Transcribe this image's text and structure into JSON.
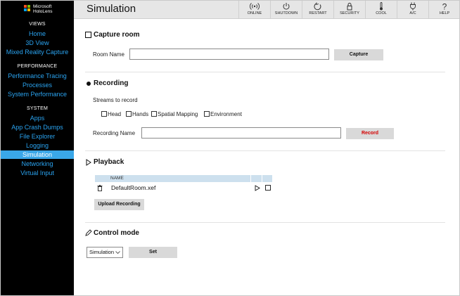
{
  "brand": {
    "line1": "Microsoft",
    "line2": "HoloLens"
  },
  "sidebar": {
    "sections": [
      {
        "title": "VIEWS",
        "items": [
          "Home",
          "3D View",
          "Mixed Reality Capture"
        ]
      },
      {
        "title": "PERFORMANCE",
        "items": [
          "Performance Tracing",
          "Processes",
          "System Performance"
        ]
      },
      {
        "title": "SYSTEM",
        "items": [
          "Apps",
          "App Crash Dumps",
          "File Explorer",
          "Logging",
          "Simulation",
          "Networking",
          "Virtual Input"
        ]
      }
    ],
    "active_item": "Simulation",
    "accent_color": "#3aa7e8",
    "link_color": "#2aa3f0"
  },
  "header": {
    "title": "Simulation",
    "buttons": [
      {
        "label": "ONLINE",
        "icon": "wifi-icon"
      },
      {
        "label": "SHUTDOWN",
        "icon": "power-icon"
      },
      {
        "label": "RESTART",
        "icon": "restart-icon"
      },
      {
        "label": "SECURITY",
        "icon": "lock-icon"
      },
      {
        "label": "COOL",
        "icon": "thermometer-icon"
      },
      {
        "label": "A/C",
        "icon": "power-plug-icon"
      },
      {
        "label": "HELP",
        "icon": "question-icon"
      }
    ]
  },
  "capture_room": {
    "heading": "Capture room",
    "room_name_label": "Room Name",
    "room_name_value": "",
    "capture_button": "Capture"
  },
  "recording": {
    "heading": "Recording",
    "streams_label": "Streams to record",
    "streams": [
      "Head",
      "Hands",
      "Spatial Mapping",
      "Environment"
    ],
    "recording_name_label": "Recording Name",
    "recording_name_value": "",
    "record_button": "Record",
    "record_color": "#d40000"
  },
  "playback": {
    "heading": "Playback",
    "columns": [
      "NAME"
    ],
    "rows": [
      {
        "name": "DefaultRoom.xef"
      }
    ],
    "upload_button": "Upload Recording"
  },
  "control_mode": {
    "heading": "Control mode",
    "selected": "Simulation",
    "set_button": "Set"
  }
}
